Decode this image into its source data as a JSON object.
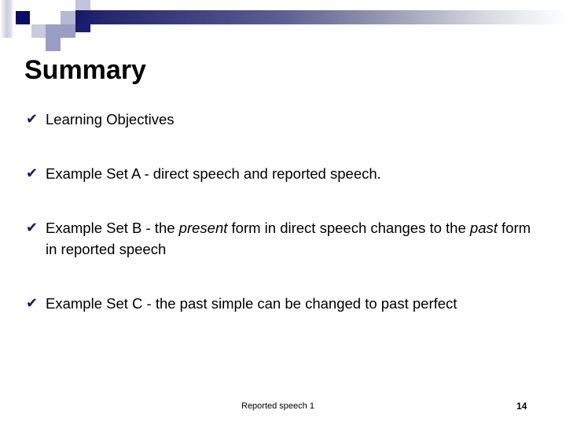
{
  "slide": {
    "title": "Summary",
    "bullet_marker": "✔",
    "bullets": [
      {
        "id": "learning-objectives",
        "segments": [
          {
            "text": "Learning Objectives",
            "italic": false
          }
        ]
      },
      {
        "id": "example-set-a",
        "segments": [
          {
            "text": "Example Set A - direct speech and reported speech.",
            "italic": false
          }
        ]
      },
      {
        "id": "example-set-b",
        "segments": [
          {
            "text": "Example Set B - the ",
            "italic": false
          },
          {
            "text": "present",
            "italic": true
          },
          {
            "text": " form in direct speech changes to the ",
            "italic": false
          },
          {
            "text": "past",
            "italic": true
          },
          {
            "text": " form in reported speech",
            "italic": false
          }
        ]
      },
      {
        "id": "example-set-c",
        "segments": [
          {
            "text": "Example Set C - the past simple can be changed to past perfect",
            "italic": false
          }
        ]
      }
    ],
    "footer": {
      "label": "Reported speech 1",
      "page_number": "14"
    },
    "colors": {
      "bar_start": "#16186e",
      "bar_end": "#ffffff",
      "marker": "#1a1a5e",
      "text": "#000000",
      "background": "#ffffff"
    }
  }
}
